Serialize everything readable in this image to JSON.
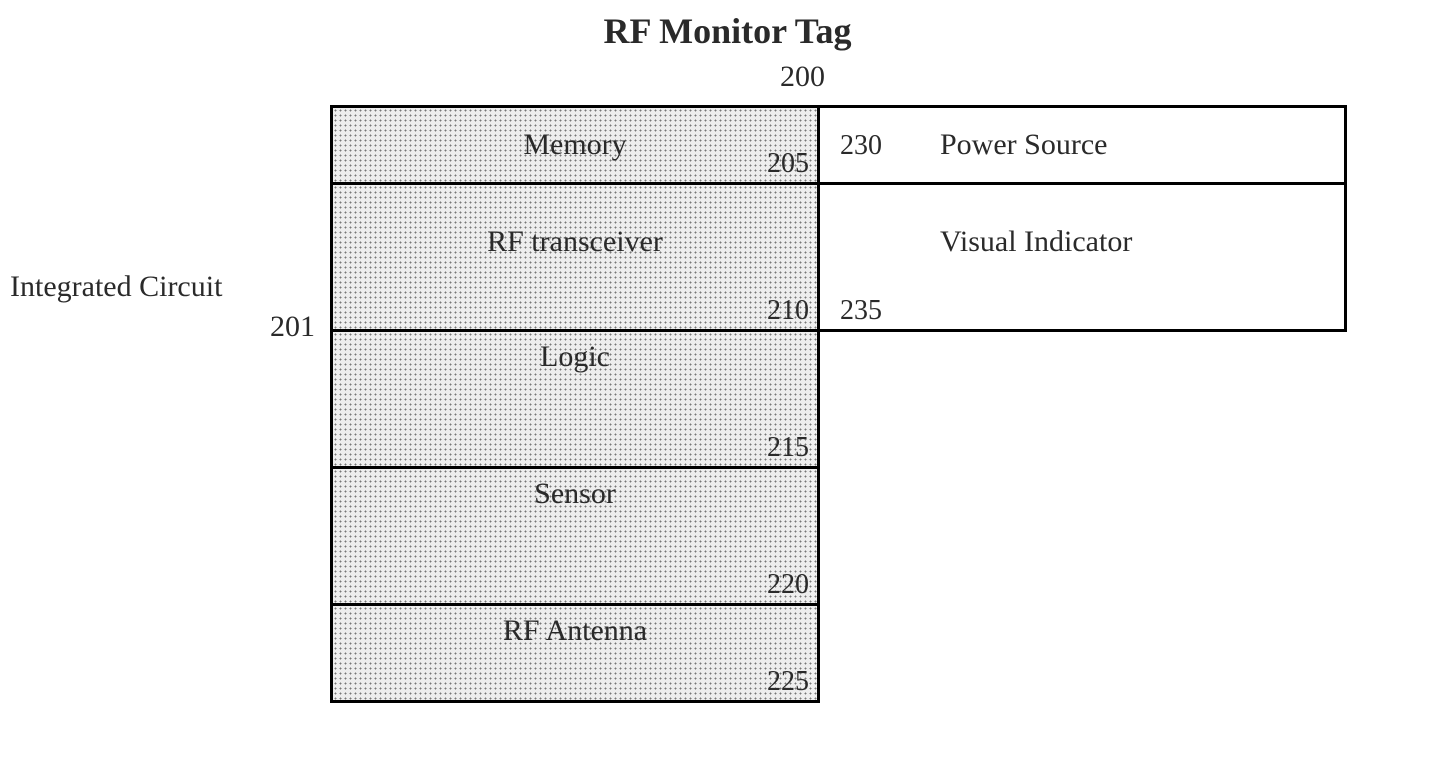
{
  "title": "RF Monitor Tag",
  "assembly_ref": "200",
  "side": {
    "label": "Integrated Circuit",
    "ref": "201"
  },
  "left_blocks": {
    "memory": {
      "label": "Memory",
      "ref": "205"
    },
    "transceiver": {
      "label": "RF transceiver",
      "ref": "210"
    },
    "logic": {
      "label": "Logic",
      "ref": "215"
    },
    "sensor": {
      "label": "Sensor",
      "ref": "220"
    },
    "antenna": {
      "label": "RF Antenna",
      "ref": "225"
    }
  },
  "right_blocks": {
    "power": {
      "label": "Power Source",
      "ref": "230"
    },
    "visual": {
      "label": "Visual Indicator",
      "ref": "235"
    }
  }
}
